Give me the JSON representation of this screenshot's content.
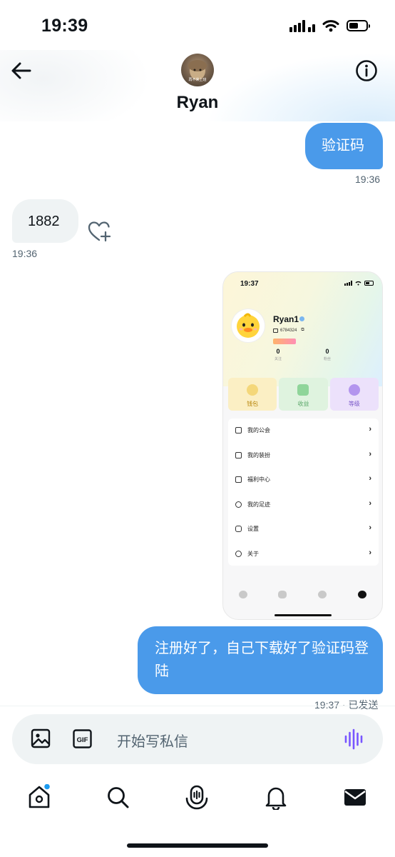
{
  "status_bar": {
    "time": "19:39"
  },
  "header": {
    "contact_name": "Ryan",
    "avatar_caption": "再不来上班"
  },
  "messages": [
    {
      "direction": "outgoing",
      "text": "验证码",
      "time": "19:36"
    },
    {
      "direction": "incoming",
      "text": "1882",
      "time": "19:36"
    },
    {
      "direction": "outgoing",
      "type": "image",
      "caption": "shared screenshot"
    },
    {
      "direction": "outgoing",
      "text": "注册好了，自己下载好了验证码登陆",
      "time": "19:37 · 已发送"
    }
  ],
  "shared_screenshot": {
    "time": "19:37",
    "profile_name": "Ryan1",
    "profile_id": "6784324",
    "stats": [
      {
        "value": "0",
        "label": "关注"
      },
      {
        "value": "0",
        "label": "粉丝"
      }
    ],
    "tiles": [
      {
        "label": "钱包",
        "color": "#fbefc4",
        "icon_color": "#f4d77a"
      },
      {
        "label": "收益",
        "color": "#dff3df",
        "icon_color": "#8fd59a"
      },
      {
        "label": "等级",
        "color": "#ece1fb",
        "icon_color": "#b395ee"
      }
    ],
    "menu": [
      "我的公会",
      "我的装扮",
      "福利中心",
      "我的足迹",
      "设置",
      "关于"
    ]
  },
  "composer": {
    "placeholder": "开始写私信"
  },
  "colors": {
    "outgoing_bubble": "#4a9aea",
    "incoming_bubble": "#eff3f4",
    "accent_voice": "#7856ff",
    "notification_dot": "#1d9bf0"
  },
  "icons": {
    "header": [
      "back-arrow-icon",
      "info-icon"
    ],
    "composer": [
      "image-icon",
      "gif-icon",
      "voice-wave-icon"
    ],
    "tabs": [
      "home-icon",
      "search-icon",
      "spaces-mic-icon",
      "bell-icon",
      "envelope-icon"
    ]
  }
}
